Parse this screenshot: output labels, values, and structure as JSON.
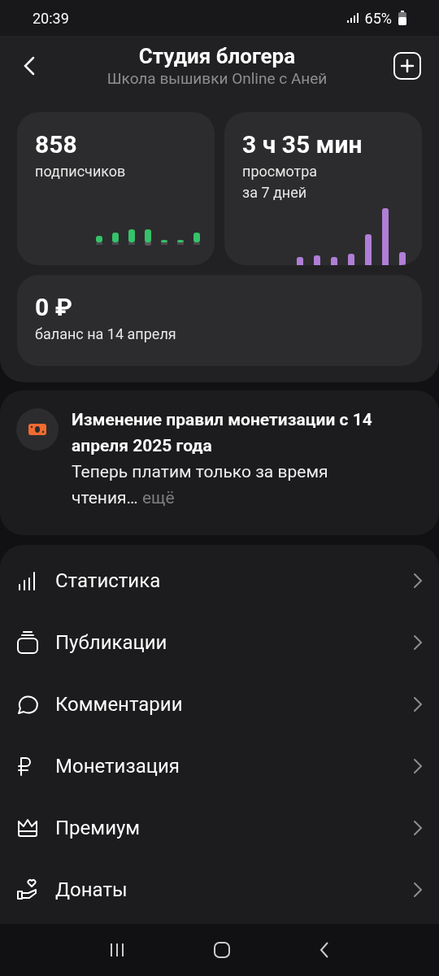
{
  "status_bar": {
    "time": "20:39",
    "battery": "65%"
  },
  "header": {
    "title": "Студия блогера",
    "subtitle": "Школа вышивки Online с Аней"
  },
  "stats": [
    {
      "kind": "subscribers",
      "value": "858",
      "label": "подписчиков"
    },
    {
      "kind": "views",
      "value": "3 ч 35 мин",
      "label": "просмотра",
      "sublabel": "за 7 дней"
    },
    {
      "kind": "balance",
      "value": "0 ₽",
      "label": "баланс на 14 апреля"
    }
  ],
  "notice": {
    "title": "Изменение правил монетизации с 14 апреля 2025 года",
    "text": "Теперь платим только за время чтения…",
    "more": "ещё"
  },
  "menu": [
    {
      "kind": "stats",
      "label": "Статистика"
    },
    {
      "kind": "publications",
      "label": "Публикации"
    },
    {
      "kind": "comments",
      "label": "Комментарии"
    },
    {
      "kind": "monetization",
      "label": "Монетизация"
    },
    {
      "kind": "premium",
      "label": "Премиум"
    },
    {
      "kind": "donations",
      "label": "Донаты"
    }
  ]
}
